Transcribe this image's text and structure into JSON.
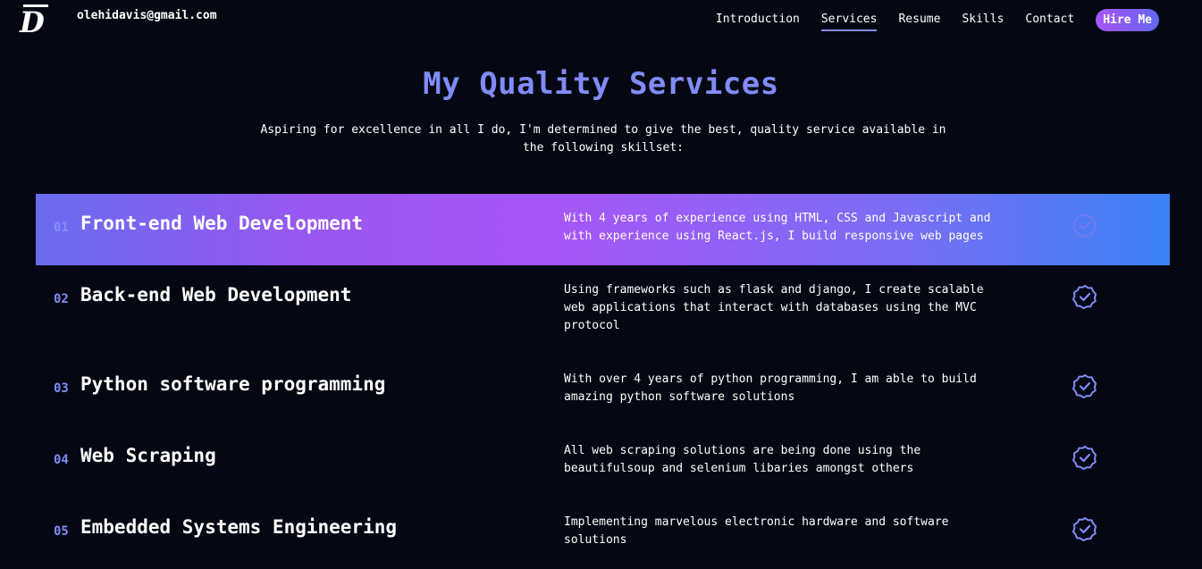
{
  "header": {
    "logo_letter": "D",
    "email": "olehidavis@gmail.com",
    "nav": {
      "introduction": "Introduction",
      "services": "Services",
      "resume": "Resume",
      "skills": "Skills",
      "contact": "Contact",
      "hire_me": "Hire Me"
    },
    "active_nav": "Services"
  },
  "hero": {
    "title": "My Quality Services",
    "subtitle": "Aspiring for excellence in all I do, I'm determined to give the best, quality service available in the following skillset:"
  },
  "services": [
    {
      "number": "01",
      "name": "Front-end Web Development",
      "description": "With 4 years of experience using HTML, CSS and Javascript and with experience using React.js, I build responsive web pages",
      "icon": "verified-check-icon"
    },
    {
      "number": "02",
      "name": "Back-end Web Development",
      "description": "Using frameworks such as flask and django, I create scalable web applications that interact with databases using the MVC protocol",
      "icon": "verified-check-icon"
    },
    {
      "number": "03",
      "name": "Python software programming",
      "description": "With over 4 years of python programming, I am able to build amazing python software solutions",
      "icon": "verified-check-icon"
    },
    {
      "number": "04",
      "name": "Web Scraping",
      "description": "All web scraping solutions are being done using the beautifulsoup and selenium libaries amongst others",
      "icon": "verified-check-icon"
    },
    {
      "number": "05",
      "name": "Embedded Systems Engineering",
      "description": "Implementing marvelous electronic hardware and software solutions",
      "icon": "verified-check-icon"
    }
  ],
  "colors": {
    "background": "#050813",
    "accent": "#818cf8",
    "highlight_gradient_start": "#6a6cf0",
    "highlight_gradient_mid": "#a855f7",
    "highlight_gradient_end": "#3b82f6"
  }
}
